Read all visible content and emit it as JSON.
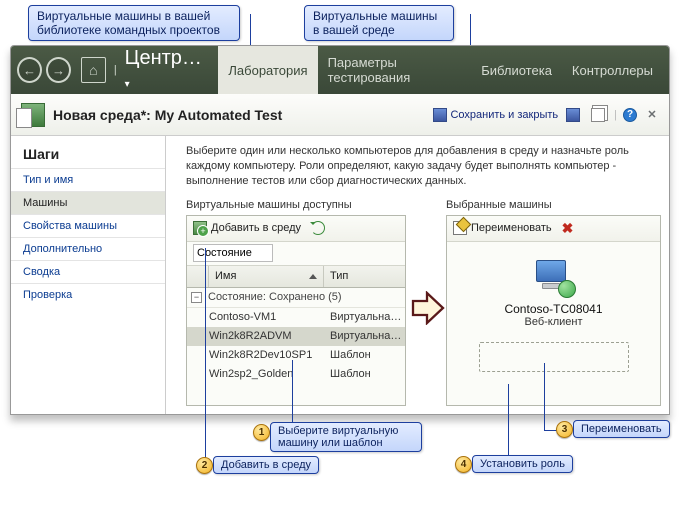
{
  "callouts": {
    "top_left": "Виртуальные машины в вашей библиотеке командных проектов",
    "top_right": "Виртуальные машины в вашей среде",
    "step1": "Выберите виртуальную машину или шаблон",
    "step2": "Добавить в среду",
    "step3": "Переименовать",
    "step4": "Установить роль"
  },
  "nav": {
    "breadcrumb": "Центр…",
    "tabs": [
      "Лаборатория",
      "Параметры тестирования",
      "Библиотека",
      "Контроллеры"
    ]
  },
  "header": {
    "title": "Новая среда*: My Automated Test",
    "save_close": "Сохранить и закрыть"
  },
  "steps": {
    "heading": "Шаги",
    "items": [
      "Тип и имя",
      "Машины",
      "Свойства машины",
      "Дополнительно",
      "Сводка",
      "Проверка"
    ],
    "selected_index": 1
  },
  "instr": "Выберите один или несколько компьютеров для добавления в среду и назначьте роль каждому компьютеру. Роли определяют, какую задачу будет выполнять компьютер - выполнение тестов или сбор диагностических данных.",
  "available": {
    "title": "Виртуальные машины доступны",
    "add_label": "Добавить в среду",
    "filter_label": "Состояние",
    "col_name": "Имя",
    "col_type": "Тип",
    "group_label": "Состояние: Сохранено (5)",
    "rows": [
      {
        "name": "Contoso-VM1",
        "type": "Виртуальная ма…"
      },
      {
        "name": "Win2k8R2ADVM",
        "type": "Виртуальная ма…"
      },
      {
        "name": "Win2k8R2Dev10SP1",
        "type": "Шаблон"
      },
      {
        "name": "Win2sp2_Golden",
        "type": "Шаблон"
      }
    ],
    "selected_row": 1
  },
  "selected": {
    "title": "Выбранные машины",
    "rename_label": "Переименовать",
    "machine_name": "Contoso-TC08041",
    "machine_role": "Веб-клиент"
  }
}
